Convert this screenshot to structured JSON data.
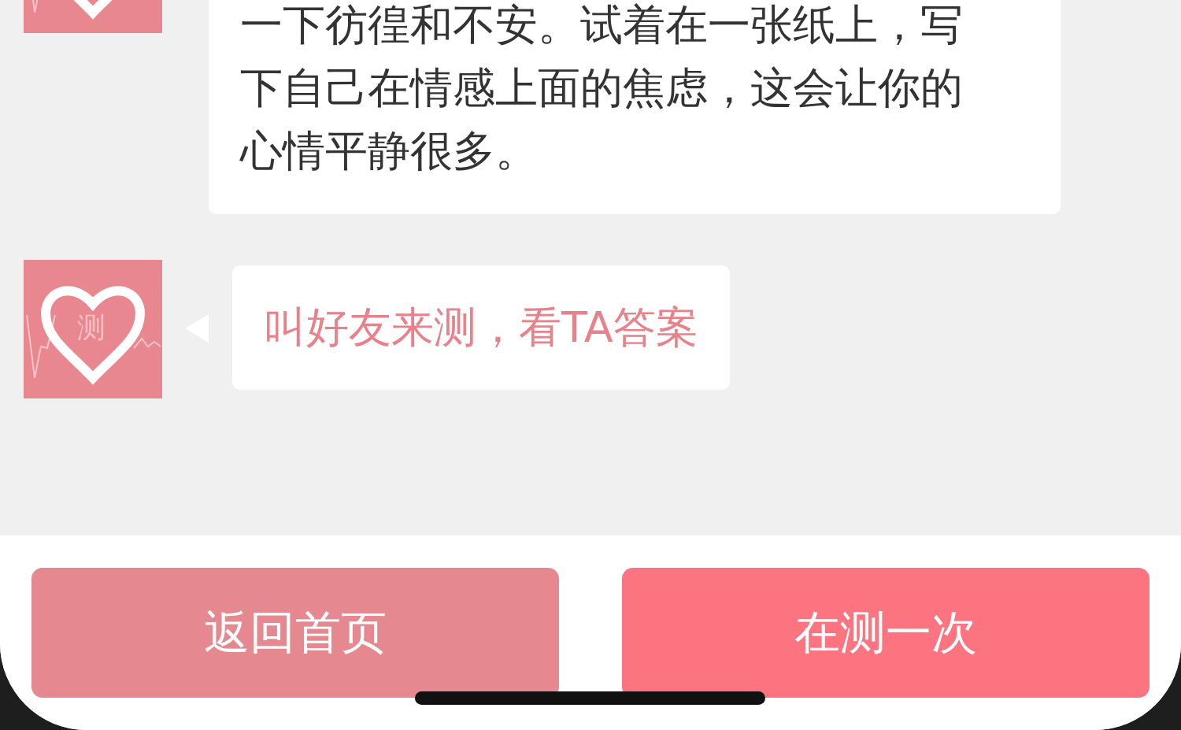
{
  "messages": [
    {
      "kind": "text",
      "lines": [
        "一下彷徨和不安。试着在一张纸上，写",
        "下自己在情感上面的焦虑，这会让你的",
        "心情平静很多。"
      ]
    },
    {
      "kind": "link",
      "avatar_label": "测",
      "lines": [
        "叫好友来测，看TA答案"
      ]
    }
  ],
  "buttons": [
    {
      "label": "返回首页",
      "color": "#e5888f"
    },
    {
      "label": "在测一次",
      "color": "#fc7480"
    }
  ]
}
